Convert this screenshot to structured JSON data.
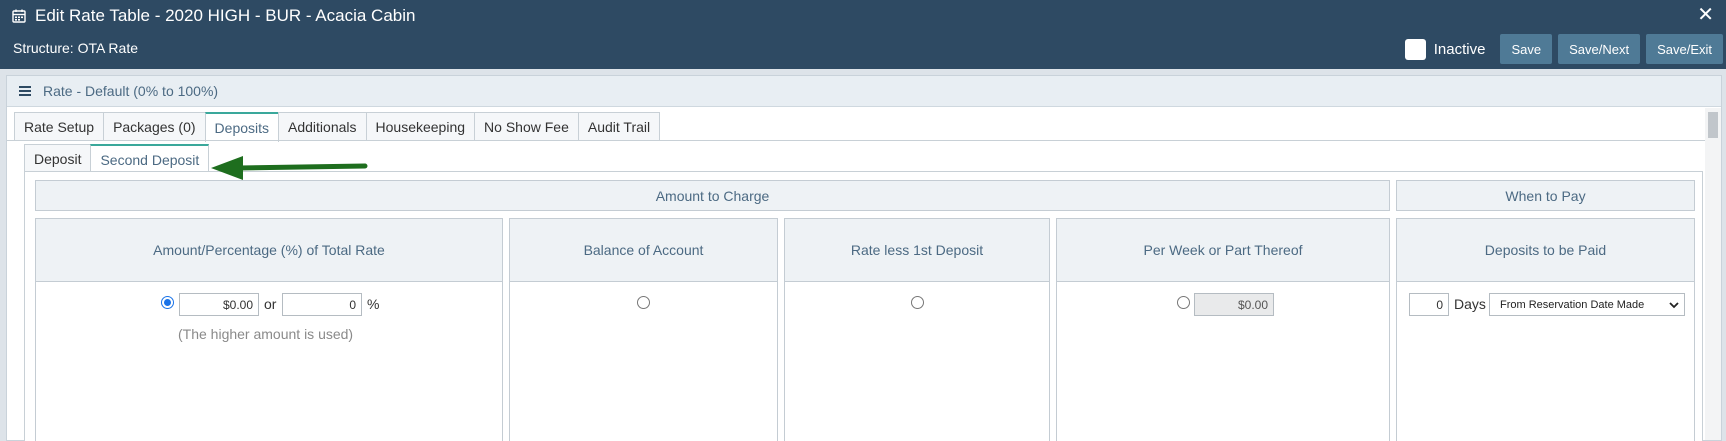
{
  "header": {
    "title": "Edit Rate Table - 2020 HIGH - BUR - Acacia Cabin",
    "structure": "Structure: OTA Rate",
    "inactive_label": "Inactive",
    "inactive_checked": false,
    "buttons": {
      "save": "Save",
      "save_next": "Save/Next",
      "save_exit": "Save/Exit"
    },
    "title_icon": "calendar-icon",
    "close_icon": "close-icon",
    "close_glyph": "✕"
  },
  "panel": {
    "title": "Rate - Default (0% to 100%)",
    "menu_icon": "hamburger-icon"
  },
  "tabs": [
    {
      "label": "Rate Setup",
      "active": false
    },
    {
      "label": "Packages (0)",
      "active": false
    },
    {
      "label": "Deposits",
      "active": true
    },
    {
      "label": "Additionals",
      "active": false
    },
    {
      "label": "Housekeeping",
      "active": false
    },
    {
      "label": "No Show Fee",
      "active": false
    },
    {
      "label": "Audit Trail",
      "active": false
    }
  ],
  "subtabs": [
    {
      "label": "Deposit",
      "active": false
    },
    {
      "label": "Second Deposit",
      "active": true
    }
  ],
  "sections": {
    "amount_to_charge": "Amount to Charge",
    "when_to_pay": "When to Pay"
  },
  "columns": {
    "amount_pct": {
      "header": "Amount/Percentage (%) of Total Rate",
      "selected": true,
      "amount_value": "$0.00",
      "or_label": "or",
      "percent_value": "0",
      "percent_sign": "%",
      "hint": "(The higher amount is used)"
    },
    "balance": {
      "header": "Balance of Account",
      "selected": false
    },
    "rate_less": {
      "header": "Rate less 1st Deposit",
      "selected": false
    },
    "per_week": {
      "header": "Per Week or Part Thereof",
      "selected": false,
      "value": "$0.00"
    },
    "deposits_paid": {
      "header": "Deposits to be Paid",
      "days_value": "0",
      "days_label": "Days",
      "when_select": "From Reservation Date Made"
    }
  },
  "colors": {
    "header_bg": "#2e4a63",
    "button_bg": "#4f7a96",
    "active_tab_accent": "#3aa89b",
    "arrow": "#1e6e1e"
  }
}
